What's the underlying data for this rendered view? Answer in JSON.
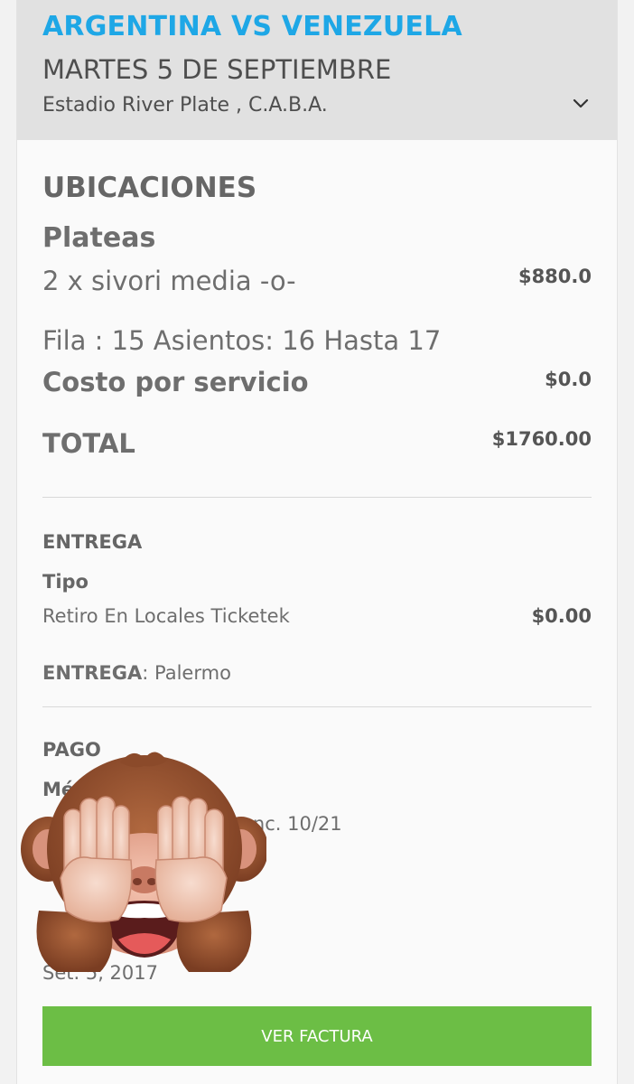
{
  "event": {
    "title": "ARGENTINA VS VENEZUELA",
    "date": "MARTES 5 DE SEPTIEMBRE",
    "venue": "Estadio River Plate , C.A.B.A."
  },
  "locations": {
    "heading": "UBICACIONES",
    "section": "Plateas",
    "ticket_line": "2 x sivori media -o-",
    "ticket_price": "$880.0",
    "seats": "Fila : 15 Asientos: 16 Hasta 17",
    "service_label": "Costo por servicio",
    "service_price": "$0.0",
    "total_label": "TOTAL",
    "total_price": "$1760.00"
  },
  "delivery": {
    "heading": "ENTREGA",
    "type_label": "Tipo",
    "type_value": "Retiro En Locales Ticketek",
    "type_price": "$0.00",
    "place_label": "ENTREGA",
    "place_value": ": Palermo"
  },
  "payment": {
    "heading": "PAGO",
    "method_label_partial": "Mé",
    "card_expiry_partial": "enc. 10/21",
    "date_partial": "Set. 5, 2017"
  },
  "actions": {
    "invoice_button": "VER FACTURA"
  },
  "icons": {
    "expand": "chevron-down-icon",
    "sticker": "see-no-evil-monkey-emoji"
  },
  "colors": {
    "accent_blue": "#1ea7e6",
    "button_green": "#6cbe45",
    "header_gray": "#e1e1e1"
  }
}
